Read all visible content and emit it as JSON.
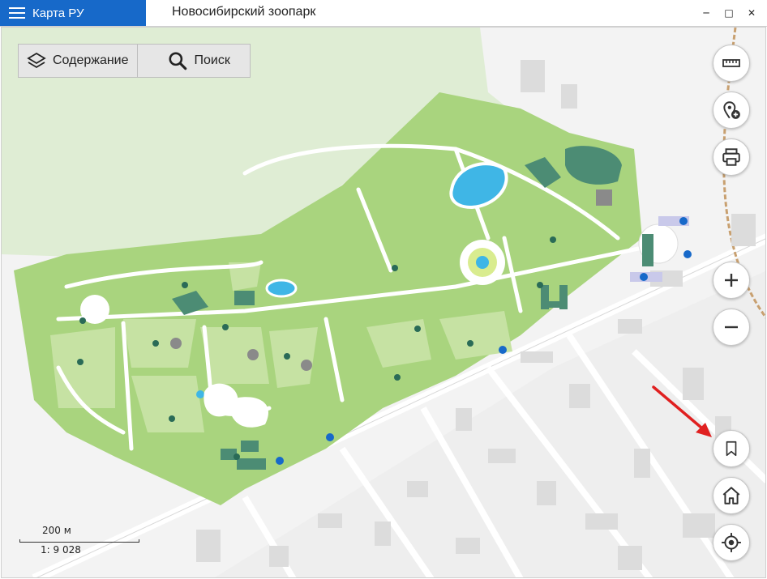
{
  "app": {
    "name": "Карта РУ"
  },
  "window": {
    "title": "Новосибирский зоопарк",
    "minimize": "─",
    "maximize": "□",
    "close": "✕"
  },
  "toolbar": {
    "contents_label": "Содержание",
    "search_label": "Поиск"
  },
  "scale": {
    "distance": "200 м",
    "ratio": "1: 9 028"
  },
  "right_controls": [
    "ruler-icon",
    "add-location-icon",
    "printer-icon",
    "zoom-in-icon",
    "zoom-out-icon",
    "bookmark-icon",
    "home-icon",
    "locate-icon"
  ],
  "colors": {
    "brand": "#1769c9",
    "park": "#a9d47e",
    "park_light": "#c6e2a3",
    "forest": "#dfedd4",
    "water": "#3fb6e6",
    "building": "#4c8c74",
    "arrow": "#e02020"
  }
}
